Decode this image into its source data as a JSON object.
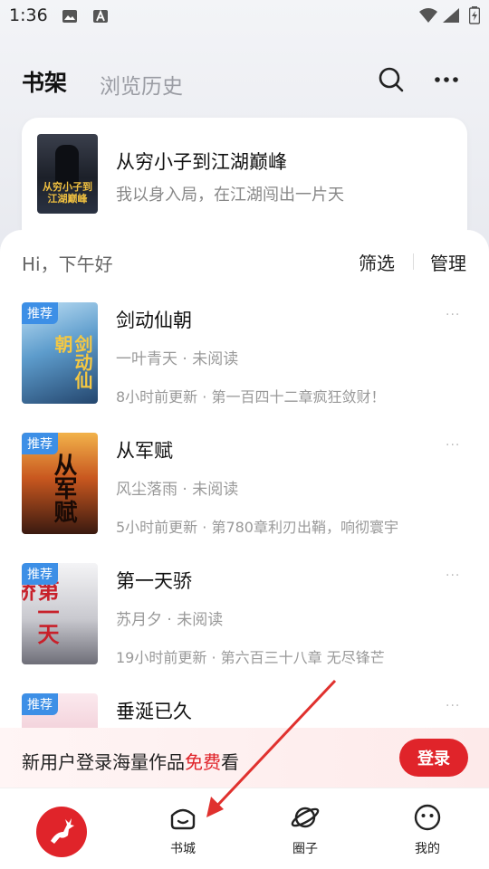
{
  "status_bar": {
    "time": "1:36"
  },
  "header": {
    "tab_shelf": "书架",
    "tab_history": "浏览历史"
  },
  "featured": {
    "title": "从穷小子到江湖巅峰",
    "subtitle": "我以身入局，在江湖闯出一片天",
    "cover_text": "从穷小子到江湖巅峰"
  },
  "shelf": {
    "greeting": "Hi，下午好",
    "filter_label": "筛选",
    "manage_label": "管理",
    "books": [
      {
        "tag": "推荐",
        "title": "剑动仙朝",
        "meta": "一叶青天 · 未阅读",
        "update": "8小时前更新 · 第一百四十二章疯狂敛财！",
        "cover_text": "剑动仙朝",
        "more": "···"
      },
      {
        "tag": "推荐",
        "title": "从军赋",
        "meta": "风尘落雨 · 未阅读",
        "update": "5小时前更新 · 第780章利刃出鞘，响彻寰宇",
        "cover_text": "从军赋",
        "more": "···"
      },
      {
        "tag": "推荐",
        "title": "第一天骄",
        "meta": "苏月夕 · 未阅读",
        "update": "19小时前更新 · 第六百三十八章 无尽锋芒",
        "cover_text": "第一天骄",
        "more": "···"
      },
      {
        "tag": "推荐",
        "title": "垂涎已久",
        "meta": "",
        "update": "",
        "cover_text": "",
        "more": "···"
      }
    ]
  },
  "promo": {
    "text_before": "新用户登录海量作品",
    "text_highlight": "免费",
    "text_after": "看",
    "login_label": "登录"
  },
  "bottom_nav": {
    "items": [
      {
        "label": "书城"
      },
      {
        "label": "圈子"
      },
      {
        "label": "我的"
      }
    ]
  },
  "colors": {
    "accent_red": "#e0242a",
    "tag_blue": "#3d8fe6",
    "muted_text": "#999999"
  }
}
